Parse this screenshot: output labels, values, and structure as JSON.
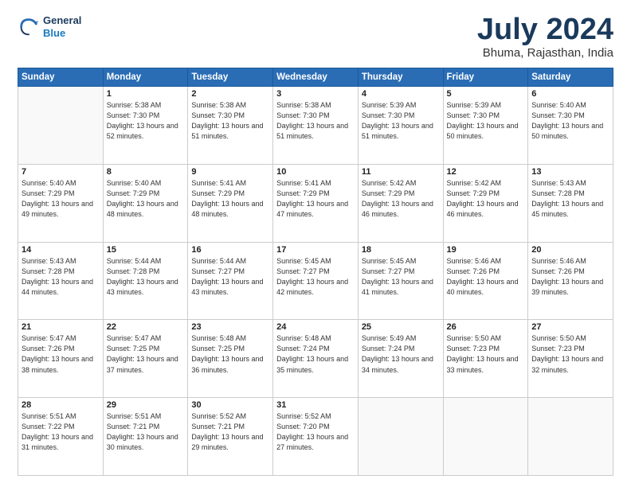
{
  "logo": {
    "line1": "General",
    "line2": "Blue"
  },
  "title": "July 2024",
  "subtitle": "Bhuma, Rajasthan, India",
  "header_days": [
    "Sunday",
    "Monday",
    "Tuesday",
    "Wednesday",
    "Thursday",
    "Friday",
    "Saturday"
  ],
  "weeks": [
    [
      {
        "day": "",
        "sunrise": "",
        "sunset": "",
        "daylight": ""
      },
      {
        "day": "1",
        "sunrise": "5:38 AM",
        "sunset": "7:30 PM",
        "daylight": "13 hours and 52 minutes."
      },
      {
        "day": "2",
        "sunrise": "5:38 AM",
        "sunset": "7:30 PM",
        "daylight": "13 hours and 51 minutes."
      },
      {
        "day": "3",
        "sunrise": "5:38 AM",
        "sunset": "7:30 PM",
        "daylight": "13 hours and 51 minutes."
      },
      {
        "day": "4",
        "sunrise": "5:39 AM",
        "sunset": "7:30 PM",
        "daylight": "13 hours and 51 minutes."
      },
      {
        "day": "5",
        "sunrise": "5:39 AM",
        "sunset": "7:30 PM",
        "daylight": "13 hours and 50 minutes."
      },
      {
        "day": "6",
        "sunrise": "5:40 AM",
        "sunset": "7:30 PM",
        "daylight": "13 hours and 50 minutes."
      }
    ],
    [
      {
        "day": "7",
        "sunrise": "5:40 AM",
        "sunset": "7:29 PM",
        "daylight": "13 hours and 49 minutes."
      },
      {
        "day": "8",
        "sunrise": "5:40 AM",
        "sunset": "7:29 PM",
        "daylight": "13 hours and 48 minutes."
      },
      {
        "day": "9",
        "sunrise": "5:41 AM",
        "sunset": "7:29 PM",
        "daylight": "13 hours and 48 minutes."
      },
      {
        "day": "10",
        "sunrise": "5:41 AM",
        "sunset": "7:29 PM",
        "daylight": "13 hours and 47 minutes."
      },
      {
        "day": "11",
        "sunrise": "5:42 AM",
        "sunset": "7:29 PM",
        "daylight": "13 hours and 46 minutes."
      },
      {
        "day": "12",
        "sunrise": "5:42 AM",
        "sunset": "7:29 PM",
        "daylight": "13 hours and 46 minutes."
      },
      {
        "day": "13",
        "sunrise": "5:43 AM",
        "sunset": "7:28 PM",
        "daylight": "13 hours and 45 minutes."
      }
    ],
    [
      {
        "day": "14",
        "sunrise": "5:43 AM",
        "sunset": "7:28 PM",
        "daylight": "13 hours and 44 minutes."
      },
      {
        "day": "15",
        "sunrise": "5:44 AM",
        "sunset": "7:28 PM",
        "daylight": "13 hours and 43 minutes."
      },
      {
        "day": "16",
        "sunrise": "5:44 AM",
        "sunset": "7:27 PM",
        "daylight": "13 hours and 43 minutes."
      },
      {
        "day": "17",
        "sunrise": "5:45 AM",
        "sunset": "7:27 PM",
        "daylight": "13 hours and 42 minutes."
      },
      {
        "day": "18",
        "sunrise": "5:45 AM",
        "sunset": "7:27 PM",
        "daylight": "13 hours and 41 minutes."
      },
      {
        "day": "19",
        "sunrise": "5:46 AM",
        "sunset": "7:26 PM",
        "daylight": "13 hours and 40 minutes."
      },
      {
        "day": "20",
        "sunrise": "5:46 AM",
        "sunset": "7:26 PM",
        "daylight": "13 hours and 39 minutes."
      }
    ],
    [
      {
        "day": "21",
        "sunrise": "5:47 AM",
        "sunset": "7:26 PM",
        "daylight": "13 hours and 38 minutes."
      },
      {
        "day": "22",
        "sunrise": "5:47 AM",
        "sunset": "7:25 PM",
        "daylight": "13 hours and 37 minutes."
      },
      {
        "day": "23",
        "sunrise": "5:48 AM",
        "sunset": "7:25 PM",
        "daylight": "13 hours and 36 minutes."
      },
      {
        "day": "24",
        "sunrise": "5:48 AM",
        "sunset": "7:24 PM",
        "daylight": "13 hours and 35 minutes."
      },
      {
        "day": "25",
        "sunrise": "5:49 AM",
        "sunset": "7:24 PM",
        "daylight": "13 hours and 34 minutes."
      },
      {
        "day": "26",
        "sunrise": "5:50 AM",
        "sunset": "7:23 PM",
        "daylight": "13 hours and 33 minutes."
      },
      {
        "day": "27",
        "sunrise": "5:50 AM",
        "sunset": "7:23 PM",
        "daylight": "13 hours and 32 minutes."
      }
    ],
    [
      {
        "day": "28",
        "sunrise": "5:51 AM",
        "sunset": "7:22 PM",
        "daylight": "13 hours and 31 minutes."
      },
      {
        "day": "29",
        "sunrise": "5:51 AM",
        "sunset": "7:21 PM",
        "daylight": "13 hours and 30 minutes."
      },
      {
        "day": "30",
        "sunrise": "5:52 AM",
        "sunset": "7:21 PM",
        "daylight": "13 hours and 29 minutes."
      },
      {
        "day": "31",
        "sunrise": "5:52 AM",
        "sunset": "7:20 PM",
        "daylight": "13 hours and 27 minutes."
      },
      {
        "day": "",
        "sunrise": "",
        "sunset": "",
        "daylight": ""
      },
      {
        "day": "",
        "sunrise": "",
        "sunset": "",
        "daylight": ""
      },
      {
        "day": "",
        "sunrise": "",
        "sunset": "",
        "daylight": ""
      }
    ]
  ]
}
